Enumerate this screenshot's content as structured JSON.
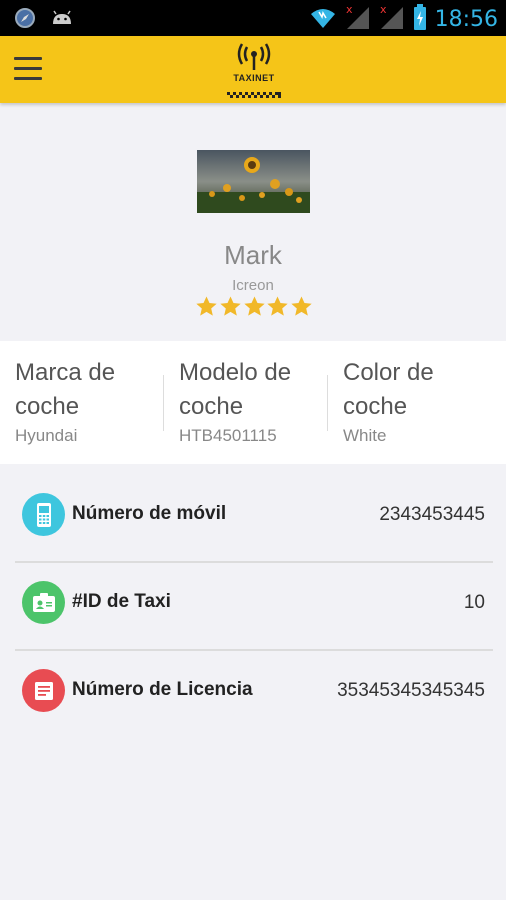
{
  "status_bar": {
    "time": "18:56"
  },
  "app_bar": {
    "logo_text": "TAXINET"
  },
  "profile": {
    "name": "Mark",
    "company": "Icreon",
    "rating": 5,
    "rating_max": 5
  },
  "car_info": [
    {
      "title": "Marca de coche",
      "value": "Hyundai"
    },
    {
      "title": "Modelo de coche",
      "value": "HTB4501115"
    },
    {
      "title": "Color de coche",
      "value": "White"
    }
  ],
  "details": [
    {
      "label": "Número de móvil",
      "value": "2343453445",
      "icon": "mobile-icon",
      "color": "#3ec6de"
    },
    {
      "label": "#ID de Taxi",
      "value": "10",
      "icon": "id-card-icon",
      "color": "#4cc46a"
    },
    {
      "label": "Número de Licencia",
      "value": "35345345345345",
      "icon": "license-icon",
      "color": "#e84c52"
    }
  ],
  "colors": {
    "app_bar": "#f5c518",
    "star": "#f1b829",
    "background": "#f2f2f6"
  }
}
